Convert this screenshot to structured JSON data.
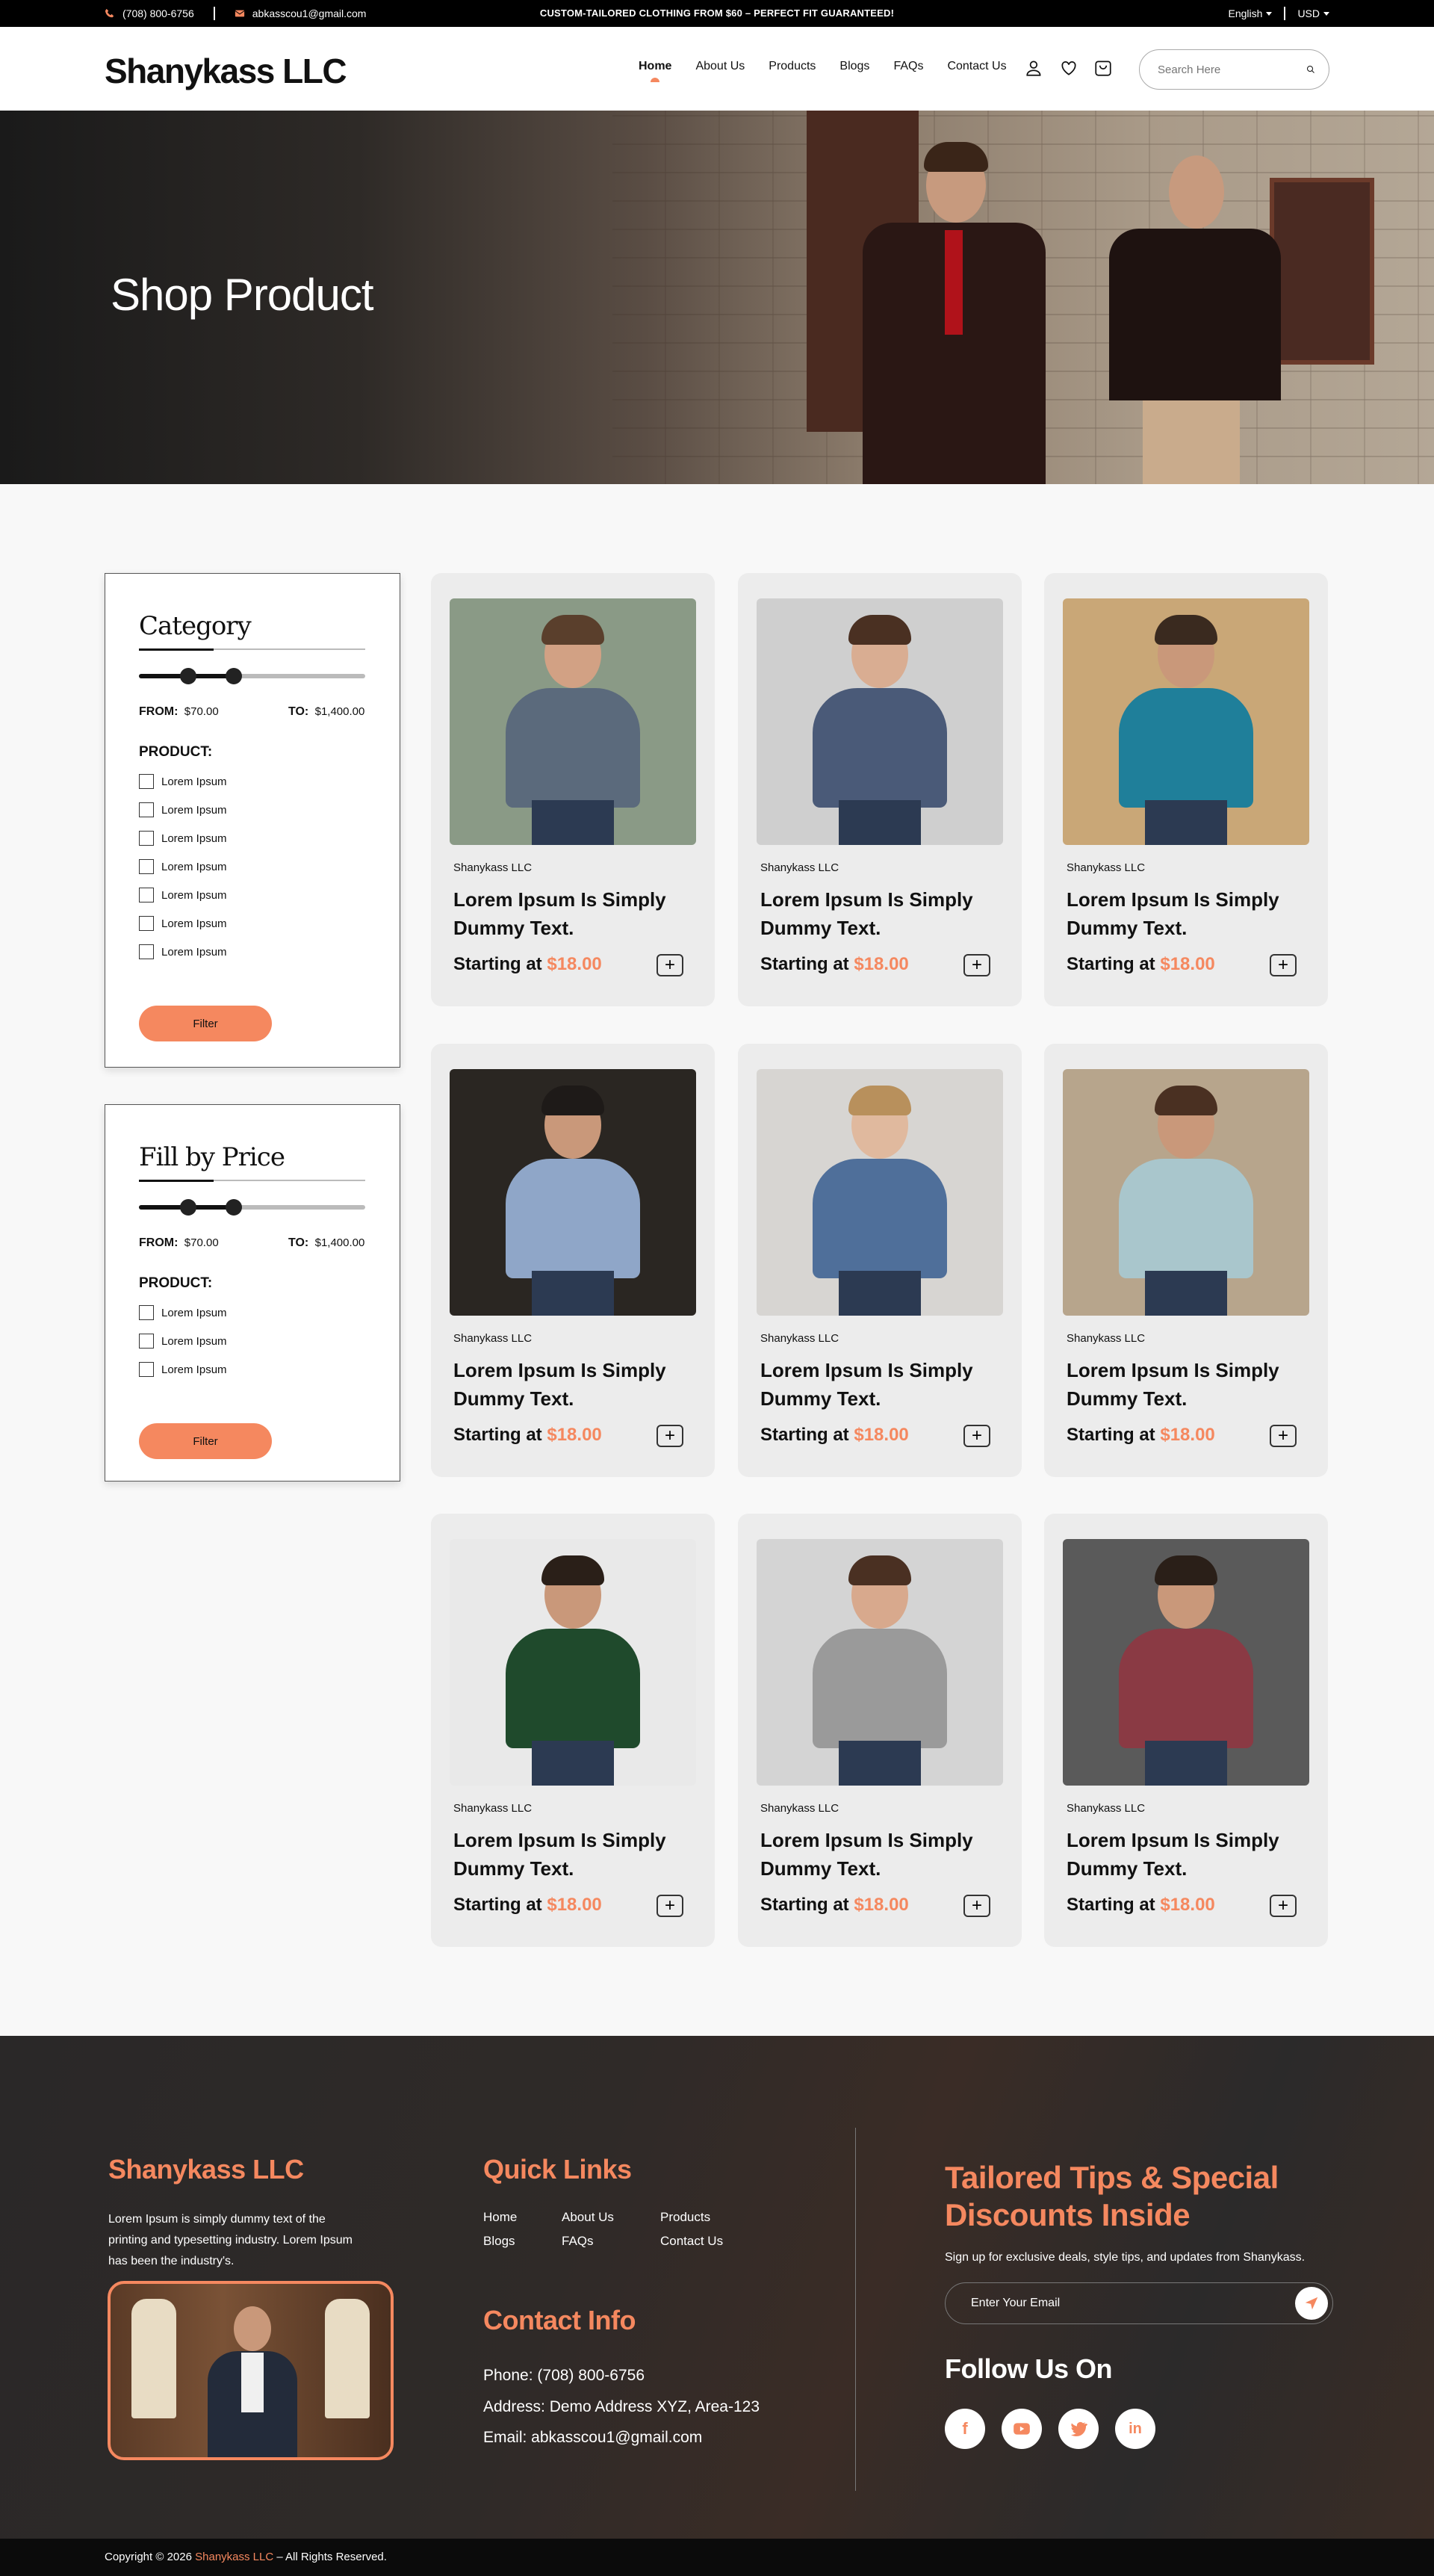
{
  "topbar": {
    "phone": "(708) 800-6756",
    "email": "abkasscou1@gmail.com",
    "promo": "CUSTOM-TAILORED CLOTHING FROM $60 – PERFECT FIT GUARANTEED!",
    "language": "English",
    "currency": "USD"
  },
  "header": {
    "logo": "Shanykass LLC",
    "nav": [
      "Home",
      "About Us",
      "Products",
      "Blogs",
      "FAQs",
      "Contact Us"
    ],
    "search_placeholder": "Search Here"
  },
  "hero": {
    "title": "Shop Product"
  },
  "filters": [
    {
      "title": "Category",
      "from_label": "FROM:",
      "from_value": "$70.00",
      "to_label": "TO:",
      "to_value": "$1,400.00",
      "product_label": "PRODUCT:",
      "options": [
        "Lorem Ipsum",
        "Lorem Ipsum",
        "Lorem Ipsum",
        "Lorem Ipsum",
        "Lorem Ipsum",
        "Lorem Ipsum",
        "Lorem Ipsum"
      ],
      "button": "Filter"
    },
    {
      "title": "Fill by Price",
      "from_label": "FROM:",
      "from_value": "$70.00",
      "to_label": "TO:",
      "to_value": "$1,400.00",
      "product_label": "PRODUCT:",
      "options": [
        "Lorem Ipsum",
        "Lorem Ipsum",
        "Lorem Ipsum"
      ],
      "button": "Filter"
    }
  ],
  "products": [
    {
      "brand": "Shanykass LLC",
      "title": "Lorem Ipsum Is Simply Dummy Text.",
      "price_label": "Starting at",
      "price": "$18.00",
      "bg": "#8a9a86",
      "top": "#5b6a7c",
      "skin": "#d2a184",
      "hair": "#5a3f2c"
    },
    {
      "brand": "Shanykass LLC",
      "title": "Lorem Ipsum Is Simply Dummy Text.",
      "price_label": "Starting at",
      "price": "$18.00",
      "bg": "#cfcfcf",
      "top": "#4a5a78",
      "skin": "#d9ad92",
      "hair": "#4a3022"
    },
    {
      "brand": "Shanykass LLC",
      "title": "Lorem Ipsum Is Simply Dummy Text.",
      "price_label": "Starting at",
      "price": "$18.00",
      "bg": "#c9a777",
      "top": "#1f7f9a",
      "skin": "#c9987a",
      "hair": "#3a2a1f"
    },
    {
      "brand": "Shanykass LLC",
      "title": "Lorem Ipsum Is Simply Dummy Text.",
      "price_label": "Starting at",
      "price": "$18.00",
      "bg": "#2a2622",
      "top": "#8fa6c8",
      "skin": "#c9987a",
      "hair": "#1e1a18"
    },
    {
      "brand": "Shanykass LLC",
      "title": "Lorem Ipsum Is Simply Dummy Text.",
      "price_label": "Starting at",
      "price": "$18.00",
      "bg": "#d7d5d2",
      "top": "#4f6f9a",
      "skin": "#e0b99e",
      "hair": "#b8905c"
    },
    {
      "brand": "Shanykass LLC",
      "title": "Lorem Ipsum Is Simply Dummy Text.",
      "price_label": "Starting at",
      "price": "$18.00",
      "bg": "#b7a58c",
      "top": "#a9c6cc",
      "skin": "#c9987a",
      "hair": "#4a3022"
    },
    {
      "brand": "Shanykass LLC",
      "title": "Lorem Ipsum Is Simply Dummy Text.",
      "price_label": "Starting at",
      "price": "$18.00",
      "bg": "#e9e9e9",
      "top": "#1f4a2c",
      "skin": "#c9987a",
      "hair": "#2a1f18"
    },
    {
      "brand": "Shanykass LLC",
      "title": "Lorem Ipsum Is Simply Dummy Text.",
      "price_label": "Starting at",
      "price": "$18.00",
      "bg": "#d4d4d4",
      "top": "#9a9a9a",
      "skin": "#d8a98d",
      "hair": "#4a3022"
    },
    {
      "brand": "Shanykass LLC",
      "title": "Lorem Ipsum Is Simply Dummy Text.",
      "price_label": "Starting at",
      "price": "$18.00",
      "bg": "#5a5a5a",
      "top": "#8a3a44",
      "skin": "#c9987a",
      "hair": "#2a1f18"
    }
  ],
  "footer": {
    "brand": "Shanykass LLC",
    "about": "Lorem Ipsum is simply dummy text of the printing and typesetting industry. Lorem Ipsum has been the industry's.",
    "quick_links_title": "Quick Links",
    "quick_links": [
      "Home",
      "About Us",
      "Products",
      "Blogs",
      "FAQs",
      "Contact Us"
    ],
    "contact_title": "Contact Info",
    "phone": "Phone: (708) 800-6756",
    "address": "Address: Demo Address XYZ, Area-123",
    "email": "Email: abkasscou1@gmail.com",
    "newsletter_title": "Tailored Tips & Special Discounts Inside",
    "newsletter_text": "Sign up for exclusive deals, style tips, and updates from Shanykass.",
    "email_placeholder": "Enter Your Email",
    "follow_title": "Follow Us On",
    "socials": [
      "facebook",
      "youtube",
      "twitter",
      "linkedin"
    ]
  },
  "copyright": {
    "prefix": "Copyright © 2026",
    "brand": "Shanykass LLC",
    "suffix": "– All Rights Reserved."
  },
  "colors": {
    "accent": "#f5885f",
    "dark": "#0b0b0b"
  }
}
